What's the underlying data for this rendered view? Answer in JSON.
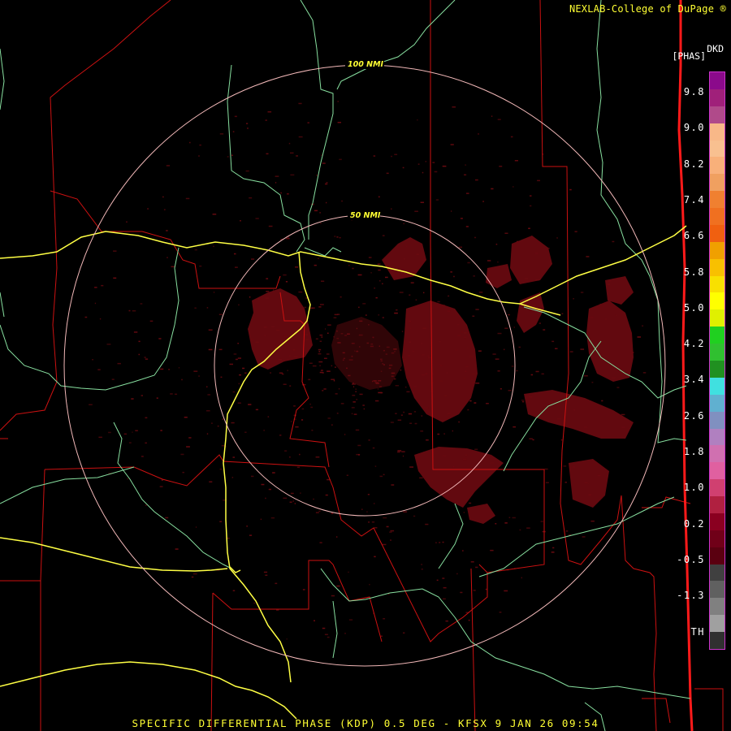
{
  "header": {
    "credit": "NEXLAB-College of DuPage ®"
  },
  "footer": {
    "caption": "SPECIFIC DIFFERENTIAL PHASE (KDP) 0.5 DEG - KFSX 9 JAN 26 09:54"
  },
  "legend": {
    "product": "DKD",
    "units": "[PHAS]",
    "labels": [
      "9.8",
      "9.0",
      "8.2",
      "7.4",
      "6.6",
      "5.8",
      "5.0",
      "4.2",
      "3.4",
      "2.6",
      "1.8",
      "1.0",
      "0.2",
      "-0.5",
      "-1.3",
      "TH"
    ],
    "colors": [
      "#8b0a8b",
      "#a0207a",
      "#b04a8a",
      "#f8b888",
      "#f8c090",
      "#f8b07a",
      "#f0a060",
      "#f08030",
      "#f07020",
      "#f06010",
      "#f0a000",
      "#f8c000",
      "#f8e000",
      "#ffff00",
      "#e0f000",
      "#20d020",
      "#30c030",
      "#209020",
      "#40e0e0",
      "#60b0d0",
      "#8090c0",
      "#b080c0",
      "#d070b0",
      "#e060a0",
      "#d04070",
      "#b02040",
      "#8a0020",
      "#700018",
      "#5a0010",
      "#404040",
      "#606060",
      "#808080",
      "#a0a0a0",
      "#303030"
    ]
  },
  "map": {
    "range_rings": [
      {
        "label": "100 NMI"
      },
      {
        "label": "50 NMI"
      }
    ],
    "colors": {
      "county": "#cc1111",
      "state": "#ff1a1a",
      "roads": "#ffff44",
      "rivers": "#88e0a0",
      "rings": "#f2b8b8",
      "echo": "#6a0a10"
    }
  }
}
